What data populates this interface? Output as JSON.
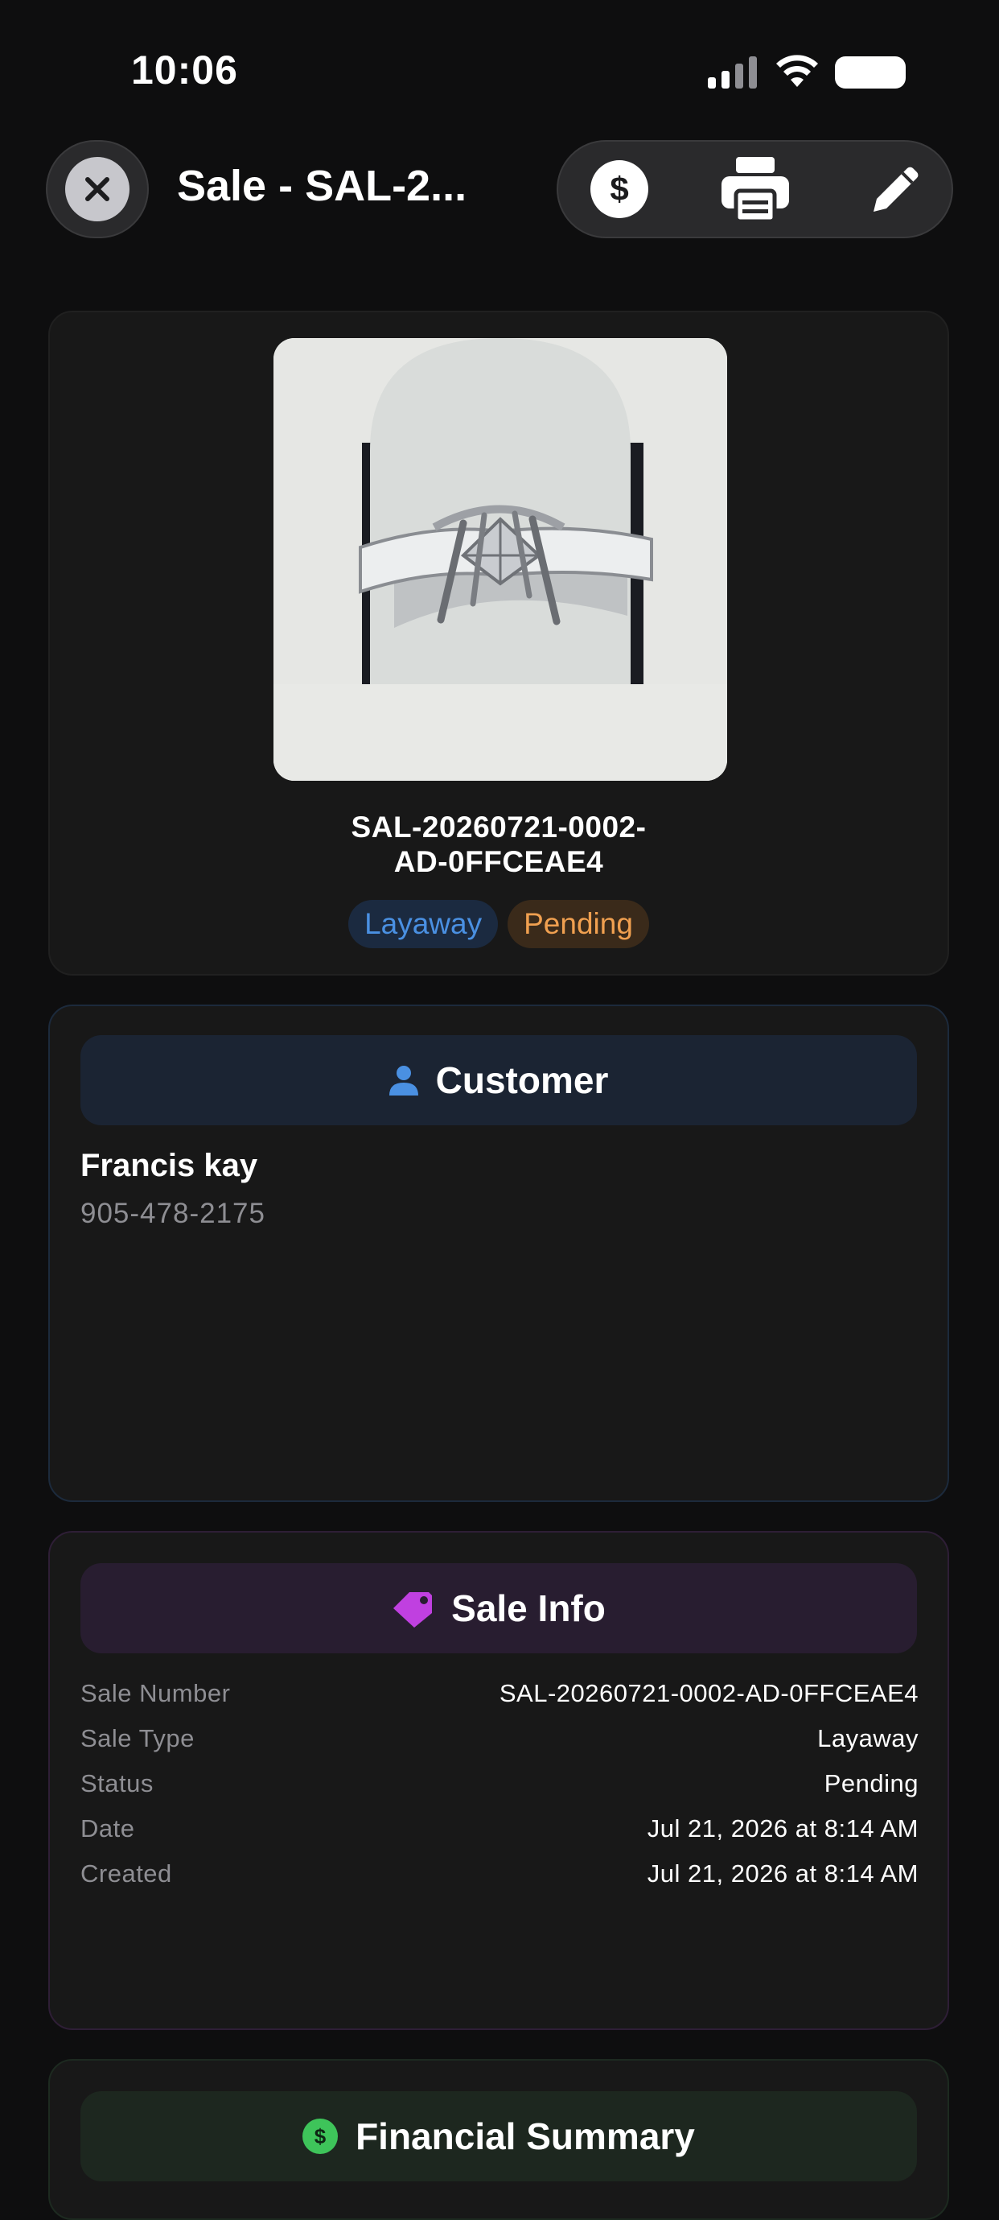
{
  "status_bar": {
    "time": "10:06"
  },
  "nav": {
    "title": "Sale - SAL-2..."
  },
  "sale": {
    "code_line1": "SAL-20260721-0002-",
    "code_line2": "AD-0FFCEAE4",
    "badges": {
      "type": "Layaway",
      "status": "Pending"
    }
  },
  "customer": {
    "header": "Customer",
    "name": "Francis kay",
    "phone": "905-478-2175"
  },
  "sale_info": {
    "header": "Sale Info",
    "rows": [
      {
        "label": "Sale Number",
        "value": "SAL-20260721-0002-AD-0FFCEAE4"
      },
      {
        "label": "Sale Type",
        "value": "Layaway"
      },
      {
        "label": "Status",
        "value": "Pending"
      },
      {
        "label": "Date",
        "value": "Jul 21, 2026 at 8:14 AM"
      },
      {
        "label": "Created",
        "value": "Jul 21, 2026 at 8:14 AM"
      }
    ]
  },
  "financial": {
    "header": "Financial Summary"
  },
  "icons": {
    "close": "close-icon",
    "dollar": "dollar-icon",
    "print": "printer-icon",
    "edit": "pencil-icon",
    "person": "person-icon",
    "tag": "tag-icon",
    "money": "dollar-circle-icon"
  },
  "colors": {
    "background": "#0e0e0f",
    "card": "#181818",
    "accent_blue": "#4a90e2",
    "accent_orange": "#f0a050",
    "accent_purple": "#c040e0",
    "accent_green": "#3ec45a"
  }
}
